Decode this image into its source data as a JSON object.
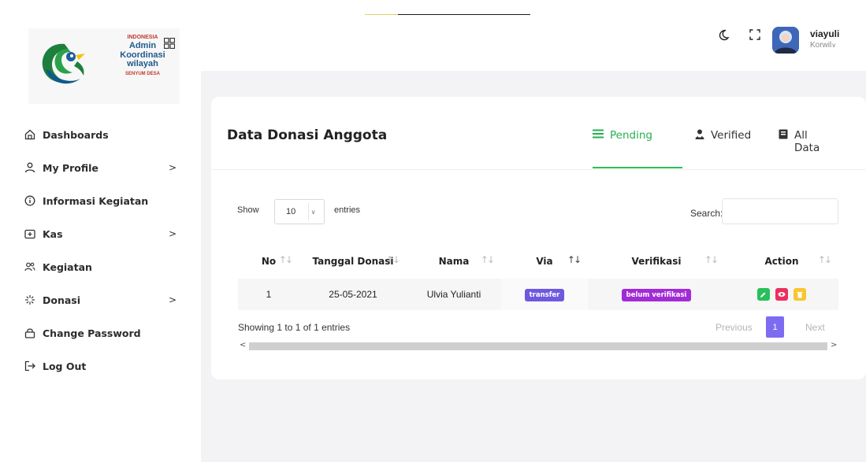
{
  "brand": {
    "line1": "INDONESIA",
    "line2": "Admin Koordinasi wilayah",
    "line3": "SENYUM DESA",
    "accent_green": "#28c058",
    "accent_purple": "#7d6cf2"
  },
  "sidebar": {
    "items": [
      {
        "label": "Dashboards",
        "icon": "home-icon",
        "has_submenu": false
      },
      {
        "label": "My Profile",
        "icon": "user-icon",
        "has_submenu": true
      },
      {
        "label": "Informasi Kegiatan",
        "icon": "info-icon",
        "has_submenu": false
      },
      {
        "label": "Kas",
        "icon": "wallet-icon",
        "has_submenu": true
      },
      {
        "label": "Kegiatan",
        "icon": "users-icon",
        "has_submenu": false
      },
      {
        "label": "Donasi",
        "icon": "spark-icon",
        "has_submenu": true
      },
      {
        "label": "Change Password",
        "icon": "lock-icon",
        "has_submenu": false
      },
      {
        "label": "Log Out",
        "icon": "logout-icon",
        "has_submenu": false
      }
    ],
    "chevron": ">"
  },
  "header": {
    "user_name": "viayuli",
    "user_role": "Korwil"
  },
  "card": {
    "title": "Data Donasi Anggota",
    "tabs": [
      {
        "label": "Pending",
        "icon": "list-icon",
        "active": true
      },
      {
        "label": "Verified",
        "icon": "user-check-icon",
        "active": false
      },
      {
        "label": "All Data",
        "icon": "book-icon",
        "active": false
      }
    ]
  },
  "datatable": {
    "show_label": "Show",
    "entries_value": "10",
    "entries_label": "entries",
    "search_label": "Search:",
    "search_value": "",
    "columns": [
      "No",
      "Tanggal Donasi",
      "Nama",
      "Via",
      "Verifikasi",
      "Action"
    ],
    "rows": [
      {
        "no": "1",
        "tanggal": "25-05-2021",
        "nama": "Ulvia Yulianti",
        "via": "transfer",
        "verifikasi": "belum verifikasi"
      }
    ],
    "info": "Showing 1 to 1 of 1 entries",
    "pagination": {
      "previous": "Previous",
      "current": "1",
      "next": "Next"
    }
  }
}
